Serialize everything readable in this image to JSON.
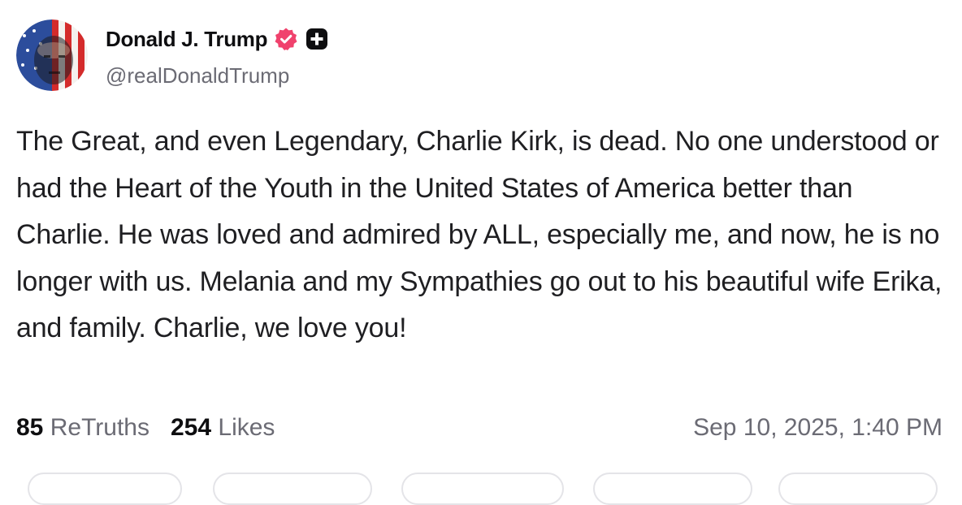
{
  "post": {
    "author": {
      "display_name": "Donald J. Trump",
      "handle": "@realDonaldTrump",
      "avatar_icon": "flag-portrait-avatar",
      "badges": [
        "verified-badge-icon",
        "plus-badge-icon"
      ],
      "verified_color": "#f0426d"
    },
    "body": "The Great, and even Legendary, Charlie Kirk, is dead. No one understood or had the Heart of the Youth in the United States of America better than Charlie. He was loved and admired by ALL, especially me, and now, he is no longer with us. Melania and my Sympathies go out to his beautiful wife Erika, and family. Charlie, we love you!",
    "stats": {
      "retruths_count": "85",
      "retruths_label": "ReTruths",
      "likes_count": "254",
      "likes_label": "Likes"
    },
    "timestamp": "Sep 10, 2025, 1:40 PM"
  },
  "colors": {
    "primary_text": "#0e0e10",
    "secondary_text": "#6b6b74",
    "pill_border": "#e4e4e8"
  }
}
